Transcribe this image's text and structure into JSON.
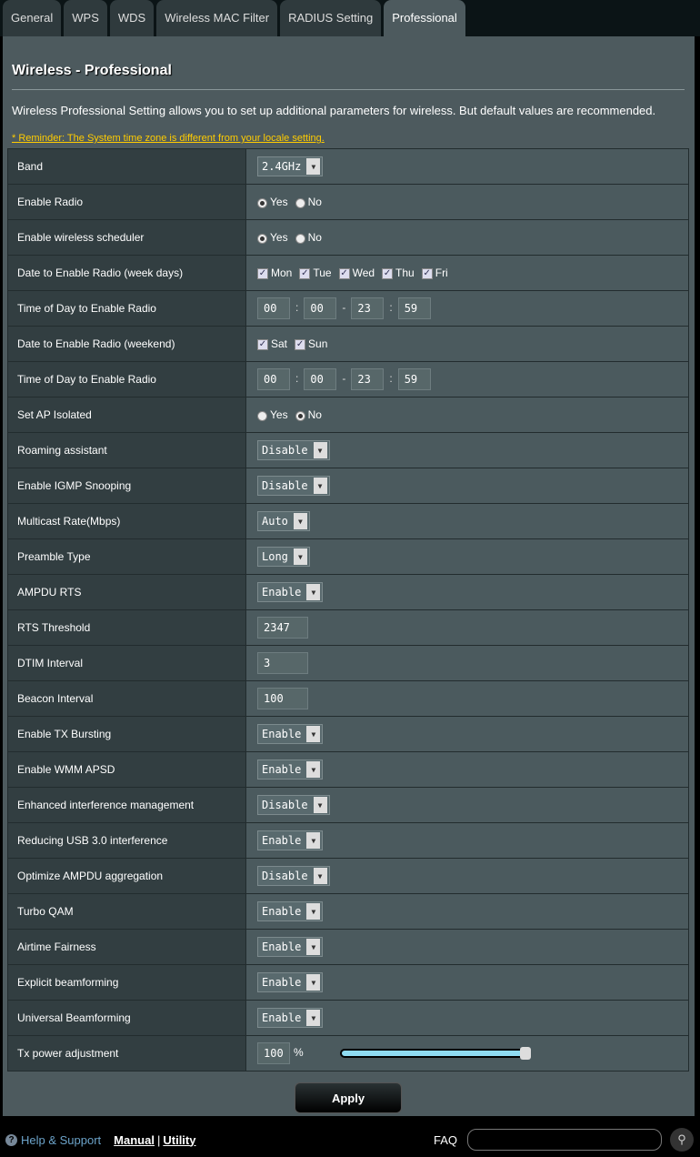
{
  "tabs": [
    {
      "label": "General"
    },
    {
      "label": "WPS"
    },
    {
      "label": "WDS"
    },
    {
      "label": "Wireless MAC Filter"
    },
    {
      "label": "RADIUS Setting"
    },
    {
      "label": "Professional",
      "active": true
    }
  ],
  "page": {
    "title": "Wireless - Professional",
    "description": "Wireless Professional Setting allows you to set up additional parameters for wireless. But default values are recommended.",
    "reminder": "* Reminder: The System time zone is different from your locale setting."
  },
  "labels": {
    "yes": "Yes",
    "no": "No",
    "percent": "%"
  },
  "rows": [
    {
      "label": "Band",
      "type": "select",
      "value": "2.4GHz"
    },
    {
      "label": "Enable Radio",
      "type": "radio",
      "value": "Yes"
    },
    {
      "label": "Enable wireless scheduler",
      "type": "radio",
      "value": "Yes"
    },
    {
      "label": "Date to Enable Radio (week days)",
      "type": "days",
      "days": [
        {
          "label": "Mon",
          "checked": true
        },
        {
          "label": "Tue",
          "checked": true
        },
        {
          "label": "Wed",
          "checked": true
        },
        {
          "label": "Thu",
          "checked": true
        },
        {
          "label": "Fri",
          "checked": true
        }
      ]
    },
    {
      "label": "Time of Day to Enable Radio",
      "type": "time",
      "values": [
        "00",
        "00",
        "23",
        "59"
      ]
    },
    {
      "label": "Date to Enable Radio (weekend)",
      "type": "days",
      "days": [
        {
          "label": "Sat",
          "checked": true
        },
        {
          "label": "Sun",
          "checked": true
        }
      ]
    },
    {
      "label": "Time of Day to Enable Radio",
      "type": "time",
      "values": [
        "00",
        "00",
        "23",
        "59"
      ]
    },
    {
      "label": "Set AP Isolated",
      "type": "radio",
      "value": "No"
    },
    {
      "label": "Roaming assistant",
      "type": "select",
      "value": "Disable"
    },
    {
      "label": "Enable IGMP Snooping",
      "type": "select",
      "value": "Disable"
    },
    {
      "label": "Multicast Rate(Mbps)",
      "type": "select",
      "value": "Auto"
    },
    {
      "label": "Preamble Type",
      "type": "select",
      "value": "Long"
    },
    {
      "label": "AMPDU RTS",
      "type": "select",
      "value": "Enable"
    },
    {
      "label": "RTS Threshold",
      "type": "input",
      "value": "2347"
    },
    {
      "label": "DTIM Interval",
      "type": "input",
      "value": "3"
    },
    {
      "label": "Beacon Interval",
      "type": "input",
      "value": "100"
    },
    {
      "label": "Enable TX Bursting",
      "type": "select",
      "value": "Enable"
    },
    {
      "label": "Enable WMM APSD",
      "type": "select",
      "value": "Enable"
    },
    {
      "label": "Enhanced interference management",
      "type": "select",
      "value": "Disable"
    },
    {
      "label": "Reducing USB 3.0 interference",
      "type": "select",
      "value": "Enable"
    },
    {
      "label": "Optimize AMPDU aggregation",
      "type": "select",
      "value": "Disable"
    },
    {
      "label": "Turbo QAM",
      "type": "select",
      "value": "Enable"
    },
    {
      "label": "Airtime Fairness",
      "type": "select",
      "value": "Enable"
    },
    {
      "label": "Explicit beamforming",
      "type": "select",
      "value": "Enable"
    },
    {
      "label": "Universal Beamforming",
      "type": "select",
      "value": "Enable"
    },
    {
      "label": "Tx power adjustment",
      "type": "slider",
      "value": "100",
      "fraction": 1.0
    }
  ],
  "apply_label": "Apply",
  "footer": {
    "help": "Help & Support",
    "manual": "Manual",
    "divider": "|",
    "utility": "Utility",
    "faq": "FAQ"
  },
  "colors": {
    "reminder": "#ffcc00",
    "slider": "#8fdcf2",
    "help": "#6ca3c9"
  }
}
